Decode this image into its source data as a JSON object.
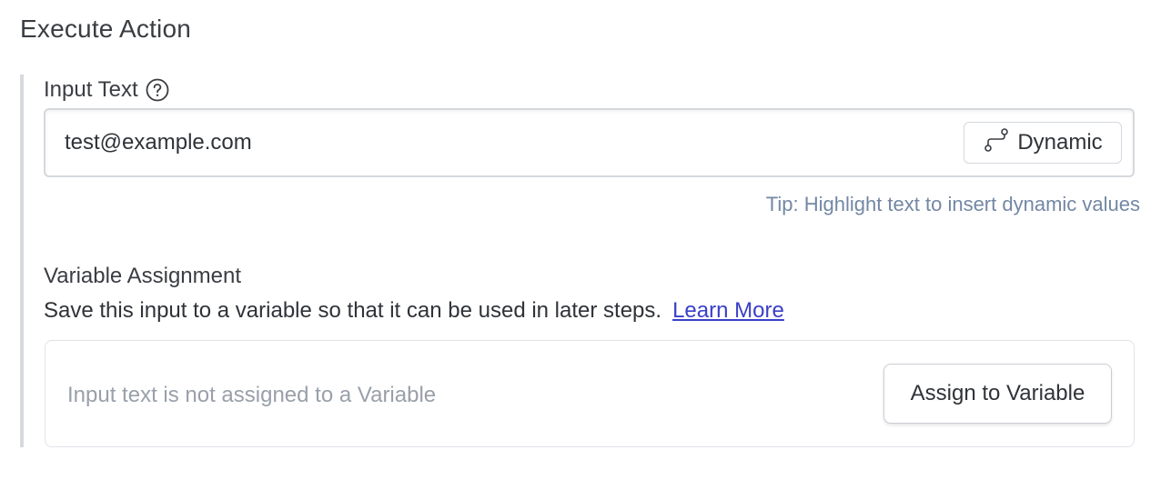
{
  "header": {
    "title": "Execute Action"
  },
  "input_text": {
    "label": "Input Text",
    "help_icon": "question-circle-icon",
    "value": "test@example.com",
    "dynamic_button": {
      "label": "Dynamic",
      "icon": "route-icon"
    },
    "tip": "Tip: Highlight text to insert dynamic values"
  },
  "variable_assignment": {
    "title": "Variable Assignment",
    "description": "Save this input to a variable so that it can be used in later steps.",
    "learn_more_label": "Learn More",
    "status_text": "Input text is not assigned to a Variable",
    "assign_button_label": "Assign to Variable"
  },
  "colors": {
    "link": "#3b40c8",
    "tip": "#7387a4",
    "panel_rule": "#d6d9de",
    "placeholder": "#99a0aa"
  }
}
